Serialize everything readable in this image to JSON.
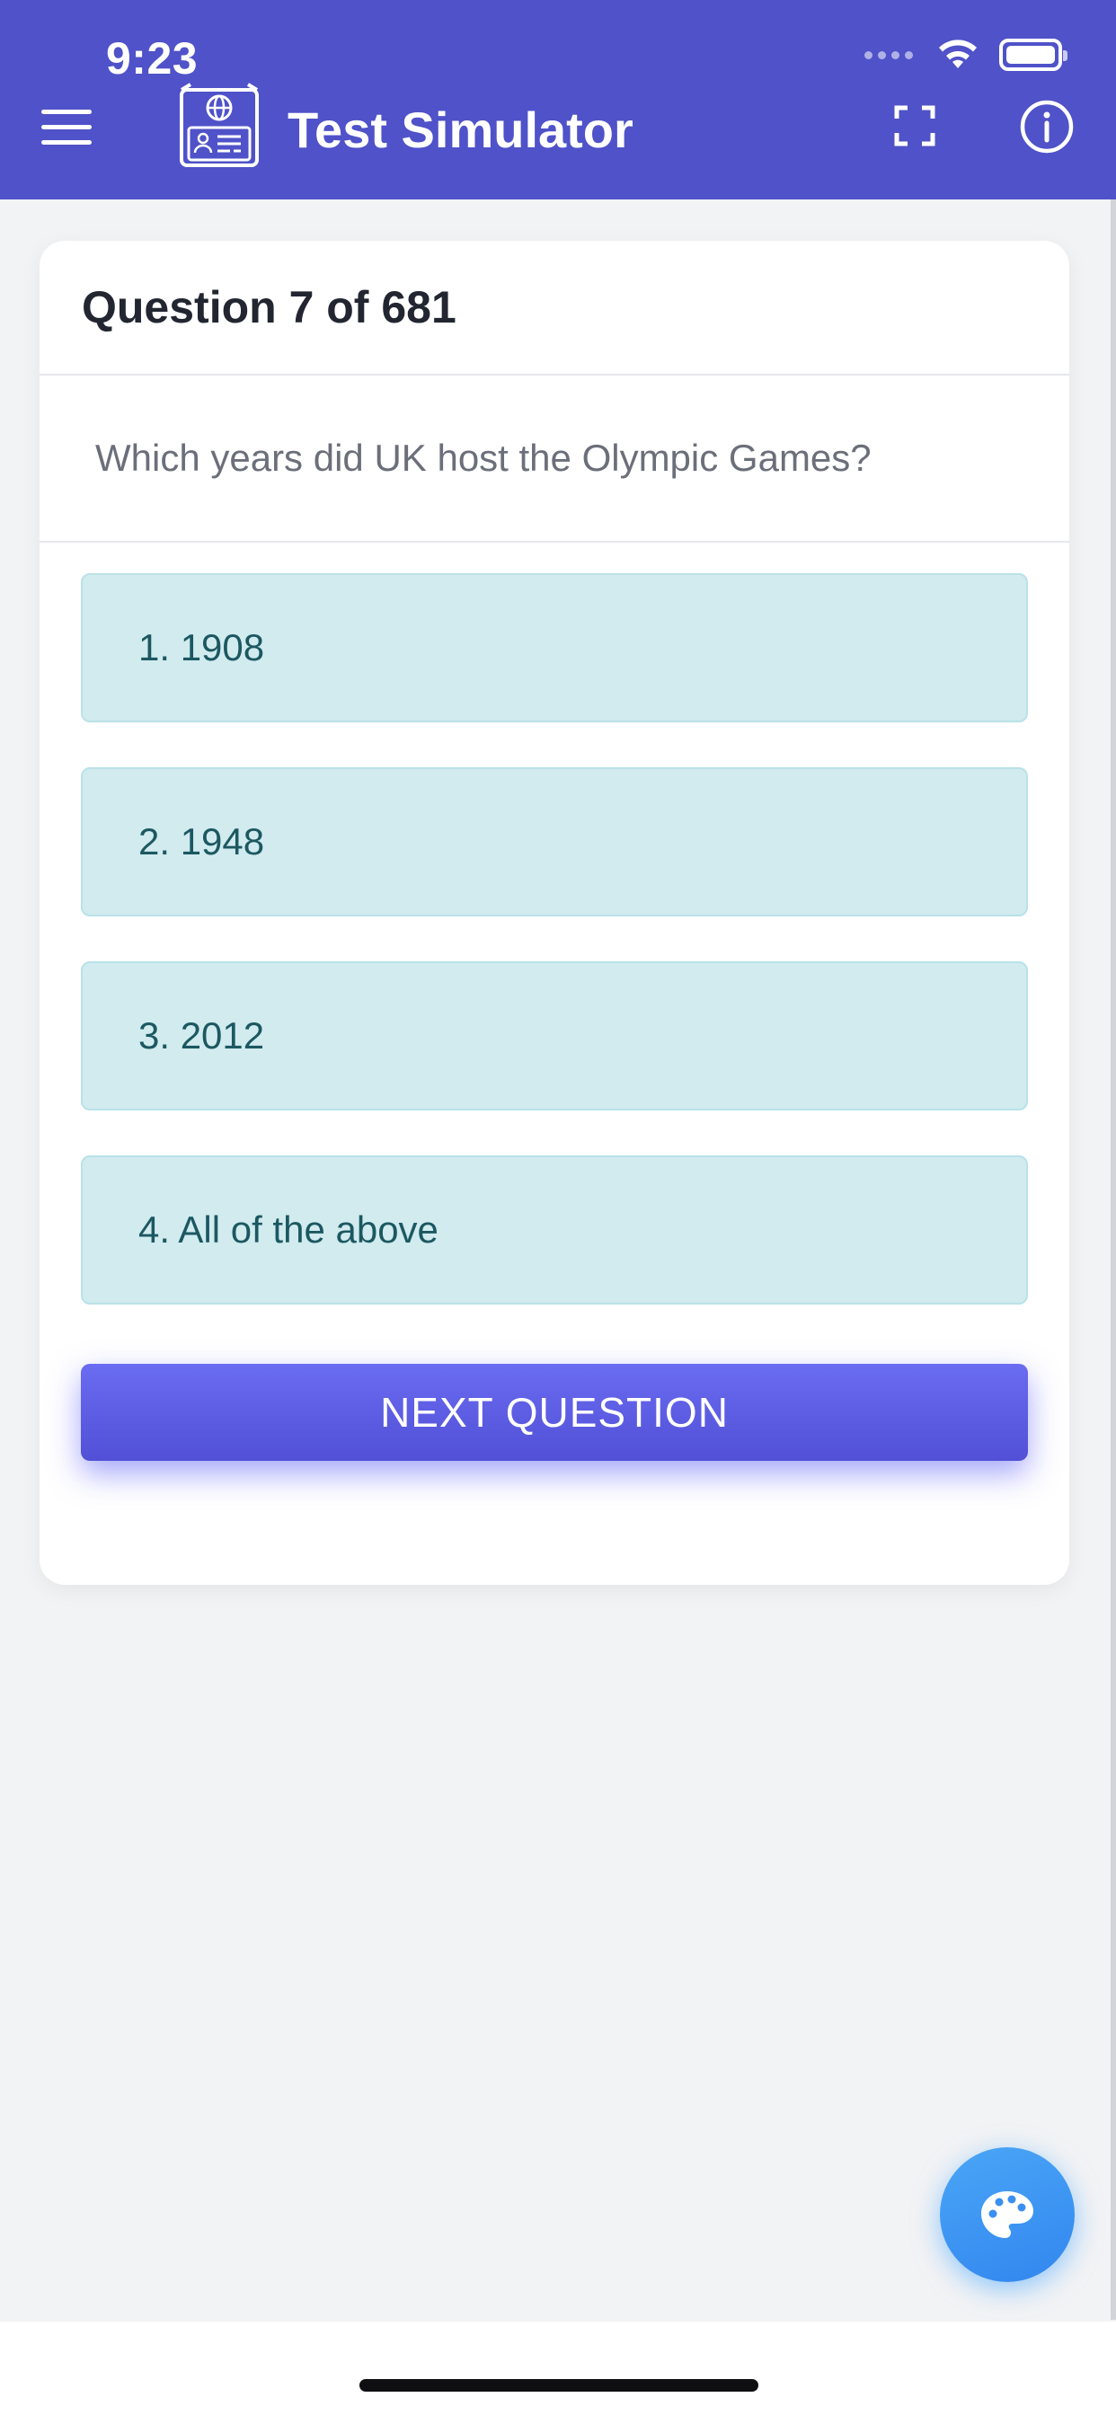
{
  "status_bar": {
    "time": "9:23",
    "icons": [
      "signal-dots-icon",
      "wifi-icon",
      "battery-icon"
    ]
  },
  "appbar": {
    "title": "Test Simulator",
    "background_color": "#4f52c8",
    "icons": {
      "menu": "menu-icon",
      "logo": "passport-id-icon",
      "expand": "fullscreen-icon",
      "info": "info-icon"
    }
  },
  "card": {
    "header": "Question 7 of 681",
    "question": "Which years did UK host the Olympic Games?",
    "options": [
      {
        "label": "1. 1908"
      },
      {
        "label": "2. 1948"
      },
      {
        "label": "3. 2012"
      },
      {
        "label": "4. All of the above"
      }
    ],
    "next_button": "NEXT QUESTION"
  },
  "fab": {
    "icon": "palette-icon",
    "color": "#3a8ff0"
  },
  "colors": {
    "option_bg": "#d1ebef",
    "option_text": "#1c5861",
    "accent": "#5a5cf0"
  }
}
